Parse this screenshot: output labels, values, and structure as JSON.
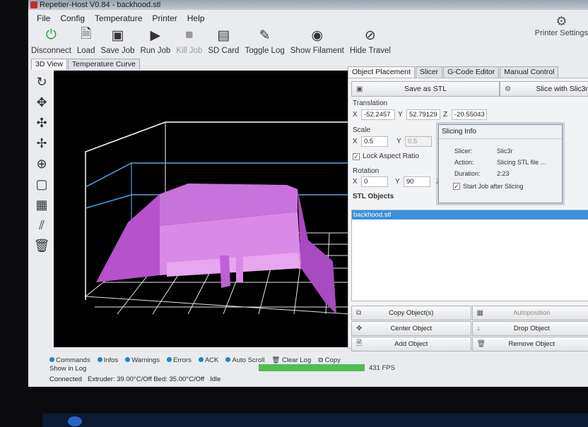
{
  "window": {
    "title": "Repetier-Host V0.84 - backhood.stl"
  },
  "menu": [
    "File",
    "Config",
    "Temperature",
    "Printer",
    "Help"
  ],
  "toolbar": {
    "items": [
      {
        "label": "Disconnect",
        "icon": "power-icon"
      },
      {
        "label": "Load",
        "icon": "document-icon"
      },
      {
        "label": "Save Job",
        "icon": "save-icon"
      },
      {
        "label": "Run Job",
        "icon": "play-icon"
      },
      {
        "label": "Kill Job",
        "icon": "stop-icon"
      },
      {
        "label": "SD Card",
        "icon": "sdcard-icon"
      },
      {
        "label": "Toggle Log",
        "icon": "pencil-icon"
      },
      {
        "label": "Show Filament",
        "icon": "eye-icon"
      },
      {
        "label": "Hide Travel",
        "icon": "eye-slash-icon"
      }
    ],
    "printer_settings": "Printer Settings"
  },
  "left_tabs": [
    "3D View",
    "Temperature Curve"
  ],
  "right_tabs": [
    "Object Placement",
    "Slicer",
    "G-Code Editor",
    "Manual Control"
  ],
  "placement": {
    "save_as_stl": "Save as STL",
    "slice_with": "Slice with Slic3r",
    "translation_label": "Translation",
    "translation": {
      "x": "-52.2457",
      "y": "52.79129",
      "z": "-20.55043"
    },
    "scale_label": "Scale",
    "scale": {
      "x": "0.5",
      "y": "0.5"
    },
    "lock_aspect": "Lock Aspect Ratio",
    "rotation_label": "Rotation",
    "rotation": {
      "x": "0",
      "y": "90"
    },
    "stl_objects_label": "STL Objects",
    "stl_objects": [
      "backhood.stl"
    ]
  },
  "actions": [
    {
      "label": "Copy Object(s)",
      "enabled": true
    },
    {
      "label": "Autoposition",
      "enabled": false
    },
    {
      "label": "Center Object",
      "enabled": true
    },
    {
      "label": "Drop Object",
      "enabled": true
    },
    {
      "label": "Add Object",
      "enabled": true
    },
    {
      "label": "Remove Object",
      "enabled": true
    }
  ],
  "slicing_info": {
    "title": "Slicing Info",
    "slicer_label": "Slicer:",
    "slicer": "Slic3r",
    "action_label": "Action:",
    "action": "Slicing STL file ...",
    "duration_label": "Duration:",
    "duration": "2:23",
    "start_after": "Start Job after Slicing"
  },
  "log": {
    "show_in_log": "Show in Log",
    "filters": [
      "Commands",
      "Infos",
      "Warnings",
      "Errors",
      "ACK",
      "Auto Scroll"
    ],
    "clear": "Clear Log",
    "copy": "Copy"
  },
  "status": {
    "connected": "Connected",
    "extruder": "Extruder: 39.00°C/Off Bed: 35.00°C/Off",
    "idle": "Idle",
    "fps": "431 FPS"
  },
  "colors": {
    "model": "#c85fd8",
    "grid": "#ffffff",
    "viewport_bg": "#000000",
    "selection": "#3b8fd9",
    "progress": "#4fbf4f"
  }
}
